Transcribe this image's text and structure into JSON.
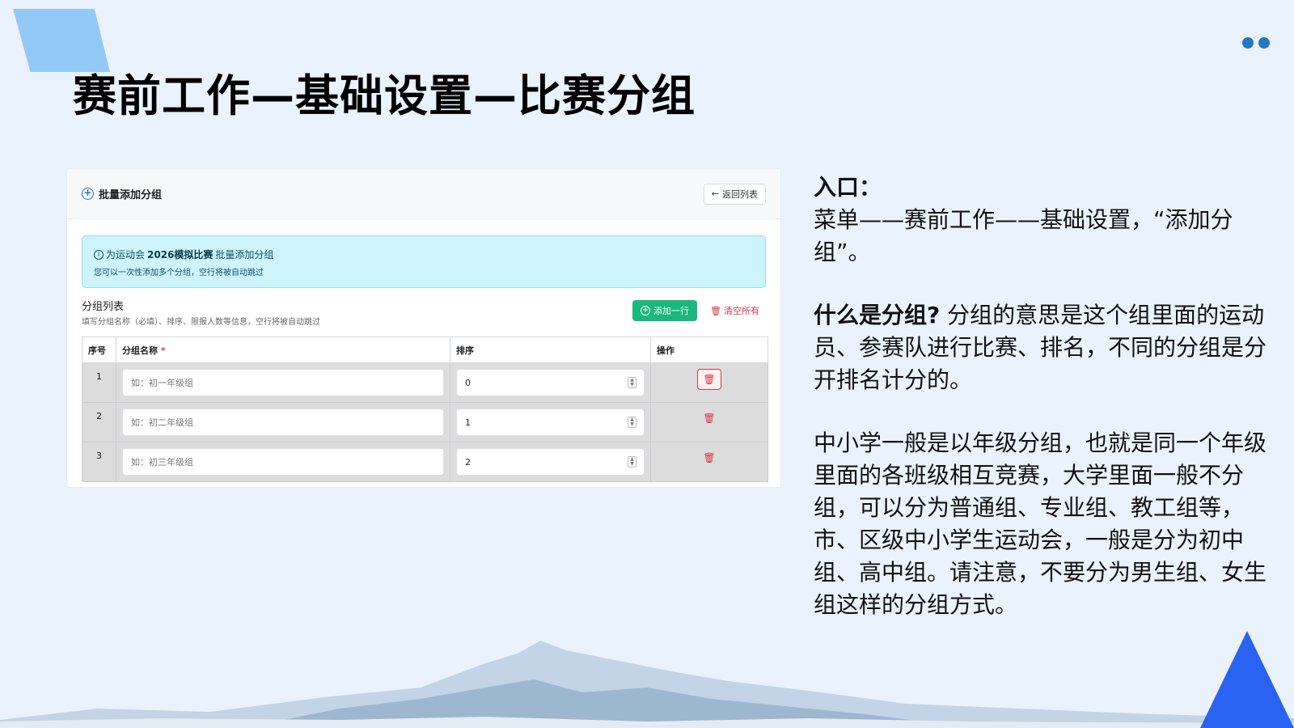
{
  "slide": {
    "title": "赛前工作—基础设置—比赛分组"
  },
  "panel": {
    "title": "批量添加分组",
    "back_label": "返回列表",
    "info": {
      "prefix": "为运动会",
      "meet_name": "2026模拟比赛",
      "suffix": "批量添加分组",
      "hint": "您可以一次性添加多个分组，空行将被自动跳过"
    },
    "list": {
      "title": "分组列表",
      "subtitle": "填写分组名称（必填）、排序、限报人数等信息，空行将被自动跳过",
      "add_row_label": "添加一行",
      "clear_all_label": "清空所有"
    },
    "table": {
      "headers": [
        "序号",
        "分组名称",
        "排序",
        "操作"
      ],
      "required_mark": "*",
      "rows": [
        {
          "seq": "1",
          "name_placeholder": "如：初一年级组",
          "sort": "0"
        },
        {
          "seq": "2",
          "name_placeholder": "如：初二年级组",
          "sort": "1"
        },
        {
          "seq": "3",
          "name_placeholder": "如：初三年级组",
          "sort": "2"
        }
      ]
    }
  },
  "explanation": {
    "entry_heading": "入口：",
    "entry_path": "菜单——赛前工作——基础设置，“添加分组”。",
    "what_heading": "什么是分组?",
    "what_text": "分组的意思是这个组里面的运动员、参赛队进行比赛、排名，不同的分组是分开排名计分的。",
    "details": "中小学一般是以年级分组，也就是同一个年级里面的各班级相互竞赛，大学里面一般不分组，可以分为普通组、专业组、教工组等，市、区级中小学生运动会，一般是分为初中组、高中组。请注意，不要分为男生组、女生组这样的分组方式。"
  },
  "colors": {
    "accent_blue": "#2a63f1",
    "success_green": "#1ab77f",
    "danger_red": "#d6394a",
    "info_bg": "#cdf3fb"
  }
}
